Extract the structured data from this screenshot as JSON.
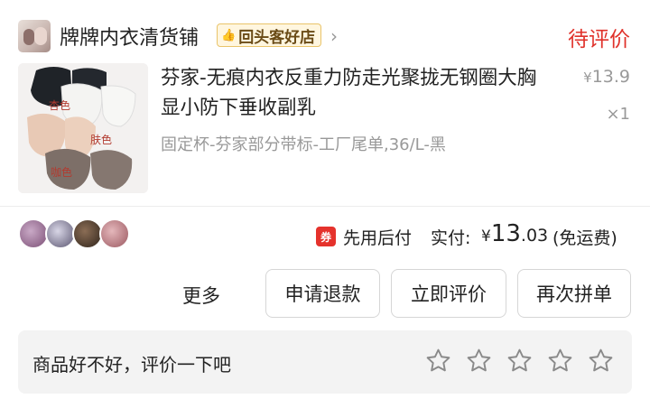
{
  "shop": {
    "name": "牌牌内衣清货铺",
    "badge": "回头客好店",
    "badge_icon": "thumbs-up-icon",
    "arrow": "›"
  },
  "order": {
    "status": "待评价",
    "status_color": "#e0322b"
  },
  "product": {
    "title": "芬家-无痕内衣反重力防走光聚拢无钢圈大胸显小防下垂收副乳",
    "spec": "固定杯-芬家部分带标-工厂尾单,36/L-黑",
    "price_currency": "¥",
    "price": "13.9",
    "quantity": "×1",
    "image_labels": [
      "杏色",
      "肤色",
      "咖色"
    ]
  },
  "summary": {
    "pay_icon": "券",
    "pay_label": "先用后付",
    "paid_label": "实付:",
    "currency": "¥",
    "amount_int": "13",
    "amount_dec": ".03",
    "shipping": "(免运费)"
  },
  "actions": {
    "more": "更多",
    "refund": "申请退款",
    "review": "立即评价",
    "regroup": "再次拼单"
  },
  "review": {
    "prompt": "商品好不好，评价一下吧",
    "star_count": 5
  },
  "colors": {
    "accent_red": "#e0322b",
    "badge_gold": "#e9c46a"
  }
}
